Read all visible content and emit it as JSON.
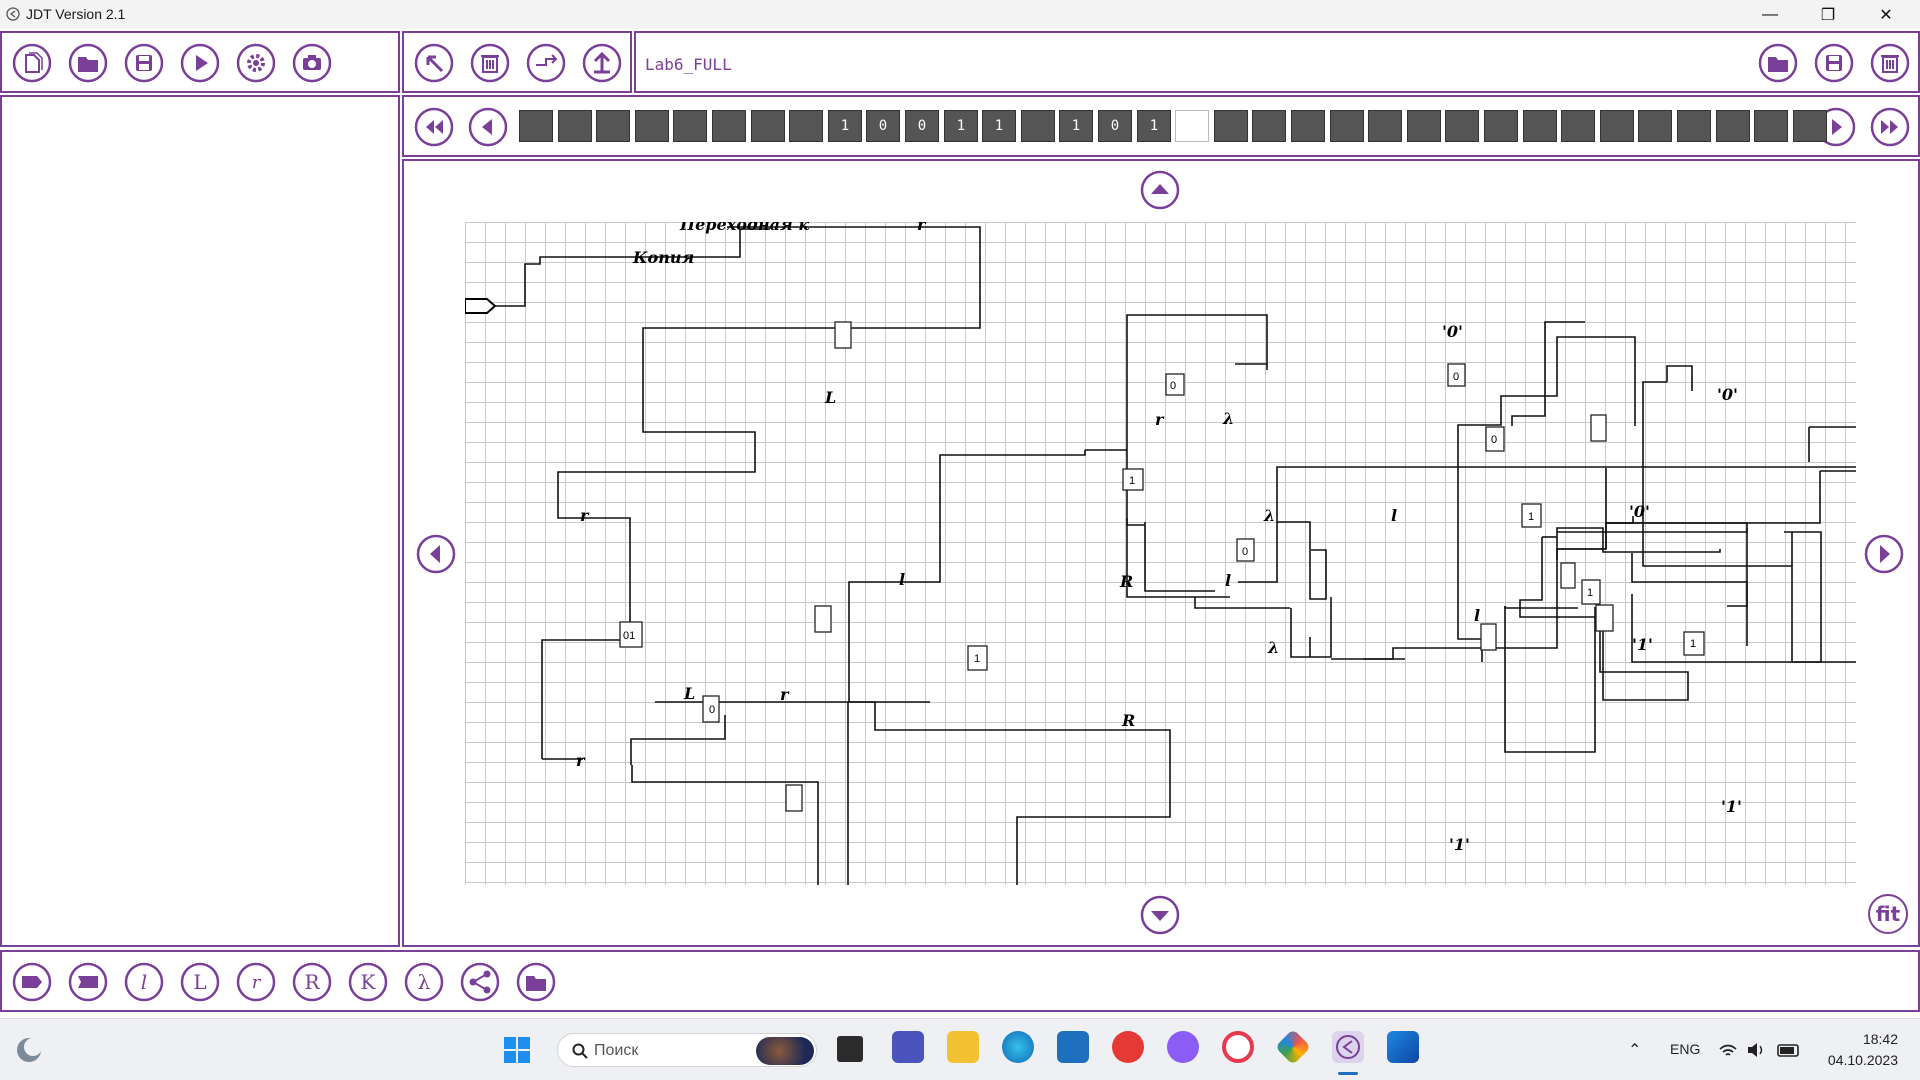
{
  "window": {
    "title": "JDT Version 2.1",
    "minimize": "—",
    "restore": "❐",
    "close": "✕"
  },
  "file_toolbar": {
    "buttons": [
      "new-file",
      "open-folder",
      "save",
      "run",
      "settings",
      "camera"
    ]
  },
  "edit_toolbar": {
    "buttons": [
      "select-arrow",
      "delete",
      "route",
      "upload"
    ]
  },
  "machine": {
    "name": "Lab6_FULL",
    "actions": [
      "open-folder",
      "save",
      "delete"
    ]
  },
  "tape": {
    "cells": [
      "",
      "",
      "",
      "",
      "",
      "",
      "",
      "",
      "1",
      "0",
      "0",
      "1",
      "1",
      "",
      "1",
      "0",
      "1",
      "",
      "",
      "",
      "",
      "",
      "",
      "",
      "",
      "",
      "",
      "",
      "",
      "",
      "",
      "",
      "",
      ""
    ],
    "head_index": 17
  },
  "diagram": {
    "labels": {
      "copy": "Копия",
      "L1": "L",
      "r1": "r",
      "r2": "r",
      "L2": "L",
      "r3": "r",
      "R1": "R",
      "l1": "l",
      "r4": "r",
      "R2": "R",
      "l2": "l",
      "l3": "l",
      "l4": "l",
      "z1": "'0'",
      "z2": "'0'",
      "z3": "'0'",
      "o1": "'1'",
      "o2": "'1'",
      "o3": "'1'",
      "lam1": "λ",
      "lam2": "λ",
      "lam3": "λ",
      "top_cut": "Переходная к",
      "top_r": "r"
    },
    "boxes": {
      "b0a": "0",
      "b1a": "1",
      "b0b": "0",
      "b01": "01",
      "b1b": "1",
      "b0c": "0",
      "b1c": "1",
      "b0d": "0",
      "b1d": "1",
      "b1e": "1",
      "b0e": "0"
    }
  },
  "nav": {
    "fit": "fit"
  },
  "bottom_toolbar": {
    "buttons": [
      "shape-tag",
      "shape-rect",
      "l-lower",
      "L-upper",
      "r-lower",
      "R-upper",
      "K-upper",
      "lambda",
      "share",
      "open-folder"
    ],
    "letters": {
      "l": "l",
      "L": "L",
      "r": "r",
      "R": "R",
      "K": "K",
      "lam": "λ"
    }
  },
  "taskbar": {
    "search_placeholder": "Поиск",
    "lang": "ENG",
    "time": "18:42",
    "date": "04.10.2023"
  },
  "colors": {
    "accent": "#7a3f98",
    "tape": "#555555"
  }
}
